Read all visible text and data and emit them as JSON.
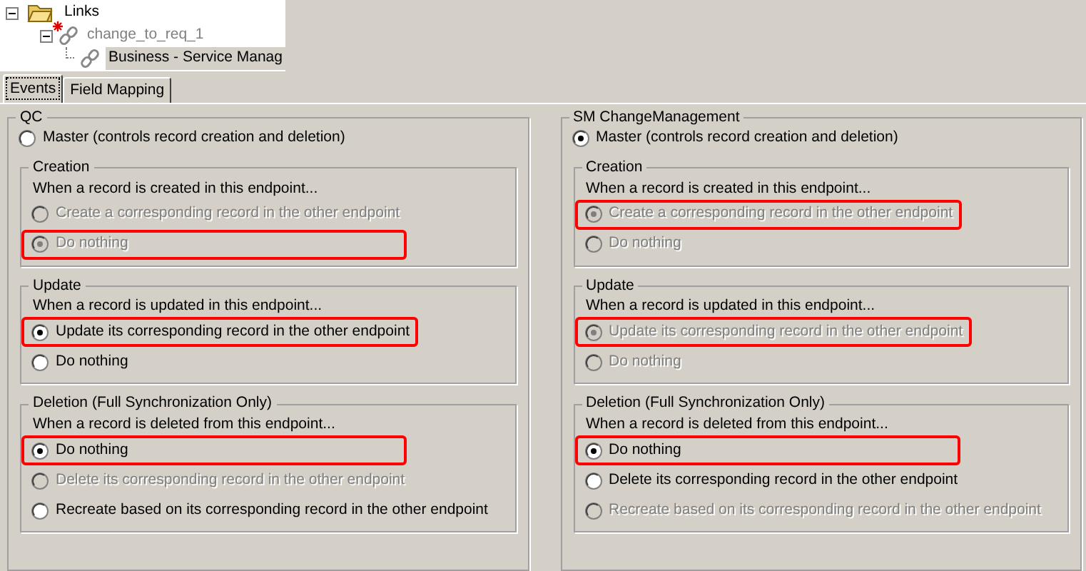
{
  "tree": {
    "label": "Links",
    "expanded": true,
    "children": [
      {
        "label": "change_to_req_1",
        "expanded": true,
        "modified": true,
        "selected": false,
        "children": [
          {
            "label": "Business - Service Manag",
            "selected": true
          }
        ]
      }
    ]
  },
  "tabs": [
    {
      "label": "Events",
      "selected": true
    },
    {
      "label": "Field Mapping",
      "selected": false
    }
  ],
  "endpoints": [
    {
      "title": "QC",
      "master": {
        "label": "Master (controls record creation and deletion)",
        "selected": false,
        "disabled": false,
        "highlighted": false
      },
      "groups": [
        {
          "title": "Creation",
          "prompt": "When a record is created in this endpoint...",
          "options": [
            {
              "label": "Create a corresponding record in the other endpoint",
              "selected": false,
              "disabled": true,
              "highlighted": false
            },
            {
              "label": "Do nothing",
              "selected": true,
              "disabled": true,
              "highlighted": true
            }
          ]
        },
        {
          "title": "Update",
          "prompt": "When a record is updated in this endpoint...",
          "options": [
            {
              "label": "Update its corresponding record in the other endpoint",
              "selected": true,
              "disabled": false,
              "highlighted": true
            },
            {
              "label": "Do nothing",
              "selected": false,
              "disabled": false,
              "highlighted": false
            }
          ]
        },
        {
          "title": "Deletion (Full Synchronization Only)",
          "prompt": "When a record is deleted from this endpoint...",
          "options": [
            {
              "label": "Do nothing",
              "selected": true,
              "disabled": false,
              "highlighted": true
            },
            {
              "label": "Delete its corresponding record in the other endpoint",
              "selected": false,
              "disabled": true,
              "highlighted": false
            },
            {
              "label": "Recreate based on its corresponding record in the other endpoint",
              "selected": false,
              "disabled": false,
              "highlighted": false
            }
          ]
        }
      ]
    },
    {
      "title": "SM ChangeManagement",
      "master": {
        "label": "Master (controls record creation and deletion)",
        "selected": true,
        "disabled": false,
        "highlighted": false
      },
      "groups": [
        {
          "title": "Creation",
          "prompt": "When a record is created in this endpoint...",
          "options": [
            {
              "label": "Create a corresponding record in the other endpoint",
              "selected": true,
              "disabled": true,
              "highlighted": true
            },
            {
              "label": "Do nothing",
              "selected": false,
              "disabled": true,
              "highlighted": false
            }
          ]
        },
        {
          "title": "Update",
          "prompt": "When a record is updated in this endpoint...",
          "options": [
            {
              "label": "Update its corresponding record in the other endpoint",
              "selected": true,
              "disabled": true,
              "highlighted": true
            },
            {
              "label": "Do nothing",
              "selected": false,
              "disabled": true,
              "highlighted": false
            }
          ]
        },
        {
          "title": "Deletion (Full Synchronization Only)",
          "prompt": "When a record is deleted from this endpoint...",
          "options": [
            {
              "label": "Do nothing",
              "selected": true,
              "disabled": false,
              "highlighted": true
            },
            {
              "label": "Delete its corresponding record in the other endpoint",
              "selected": false,
              "disabled": false,
              "highlighted": false
            },
            {
              "label": "Recreate based on its corresponding record in the other endpoint",
              "selected": false,
              "disabled": true,
              "highlighted": false
            }
          ]
        }
      ]
    }
  ]
}
